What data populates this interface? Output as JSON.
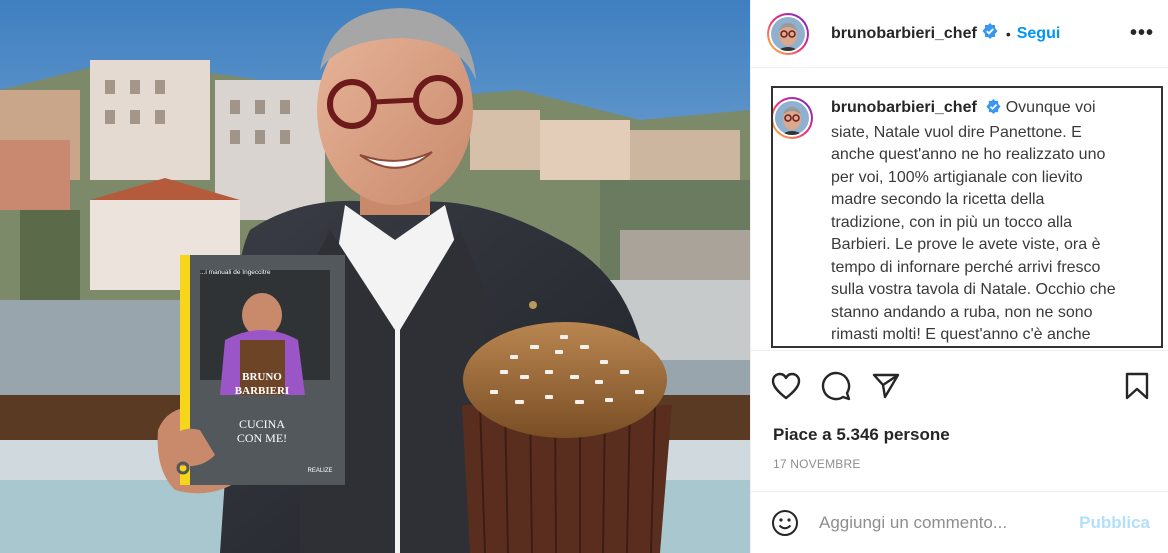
{
  "post": {
    "username": "brunobarbieri_chef",
    "separator": "•",
    "follow_label": "Segui",
    "more_label": "•••",
    "caption_lines": [
      "Ovunque voi",
      "siate, Natale vuol dire Panettone. E",
      "anche quest'anno ne ho realizzato uno",
      "per voi, 100% artigianale con lievito",
      "madre secondo la ricetta della",
      "tradizione, con in più un tocco alla",
      "Barbieri. Le prove le avete viste, ora è",
      "tempo di infornare perché arrivi fresco",
      "sulla vostra tavola di Natale. Occhio che",
      "stanno andando a ruba, non ne sono",
      "rimasti molti! E quest'anno c'è anche"
    ],
    "likes_text": "Piace a 5.346 persone",
    "date_text": "17 NOVEMBRE",
    "comment_placeholder": "Aggiungi un commento...",
    "publish_label": "Pubblica"
  },
  "book": {
    "top_text": "...i manuali de Ingeccitre",
    "author_line1": "BRUNO",
    "author_line2": "BARBIERI",
    "title_line1": "CUCINA",
    "title_line2": "CON ME!",
    "publisher": "REALIZE"
  },
  "colors": {
    "accent": "#0095f6",
    "publish_disabled": "#b2dffc",
    "verified": "#3897f0"
  },
  "icons": {
    "like": "heart-icon",
    "comment": "comment-icon",
    "share": "share-icon",
    "save": "bookmark-icon",
    "emoji": "emoji-icon",
    "verified": "verified-badge-icon"
  }
}
